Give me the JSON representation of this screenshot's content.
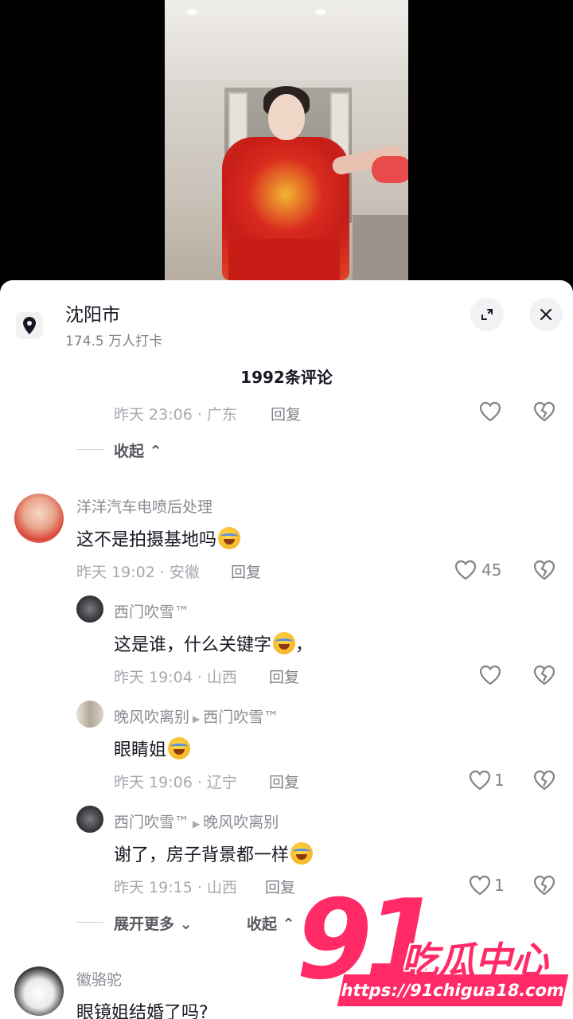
{
  "location": {
    "name": "沈阳市",
    "checkins": "174.5 万人打卡"
  },
  "icons": {
    "pin": "location-pin-icon",
    "expand": "expand-icon",
    "close": "close-icon",
    "like": "heart-icon",
    "dislike": "broken-heart-icon"
  },
  "comments_header": "1992条评论",
  "top_partial": {
    "meta": "昨天 23:06 · 广东",
    "reply": "回复"
  },
  "collapse_top": "收起",
  "comment1": {
    "author": "洋洋汽车电喷后处理",
    "text": "这不是拍摄基地吗",
    "meta": "昨天 19:02 · 安徽",
    "reply": "回复",
    "likes": "45"
  },
  "reply1": {
    "author": "西门吹雪™",
    "text": "这是谁，什么关键字",
    "text_tail": "，",
    "meta": "昨天 19:04 · 山西",
    "reply": "回复"
  },
  "reply2": {
    "author": "晚风吹离别",
    "to": "西门吹雪™",
    "text": "眼睛姐",
    "meta": "昨天 19:06 · 辽宁",
    "reply": "回复",
    "likes": "1"
  },
  "reply3": {
    "author": "西门吹雪™",
    "to": "晚风吹离别",
    "text": "谢了，房子背景都一样",
    "meta": "昨天 19:15 · 山西",
    "reply": "回复",
    "likes": "1"
  },
  "expand_more": "展开更多",
  "collapse_bottom": "收起",
  "comment2": {
    "author": "徽骆驼",
    "text": "眼镜姐结婚了吗?"
  },
  "watermark": {
    "number": "91",
    "title": "吃瓜中心",
    "url": "https://91chigua18.com"
  },
  "colors": {
    "accent_watermark": "#ff2a66",
    "text_primary": "#161823",
    "text_secondary": "#80838a"
  }
}
